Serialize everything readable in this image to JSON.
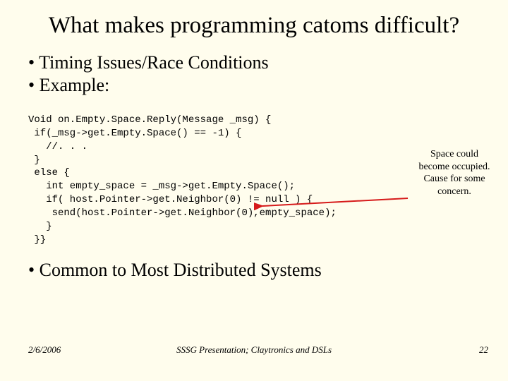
{
  "title": "What makes programming catoms difficult?",
  "bullets": {
    "b1": "Timing Issues/Race Conditions",
    "b2": "Example:",
    "b3": "Common to Most Distributed Systems"
  },
  "code": {
    "l1": "Void on.Empty.Space.Reply(Message _msg) {",
    "l2": " if(_msg->get.Empty.Space() == -1) {",
    "l3": "   //. . .",
    "l4": " }",
    "l5": " else {",
    "l6": "   int empty_space = _msg->get.Empty.Space();",
    "l7": "   if( host.Pointer->get.Neighbor(0) != null ) {",
    "l8": "    send(host.Pointer->get.Neighbor(0),empty_space);",
    "l9": "   }",
    "l10": " }}"
  },
  "annotation": "Space could become occupied. Cause for some concern.",
  "footer": {
    "date": "2/6/2006",
    "center": "SSSG Presentation; Claytronics and DSLs",
    "page": "22"
  },
  "colors": {
    "background": "#fffded",
    "arrow": "#d61a1a"
  }
}
